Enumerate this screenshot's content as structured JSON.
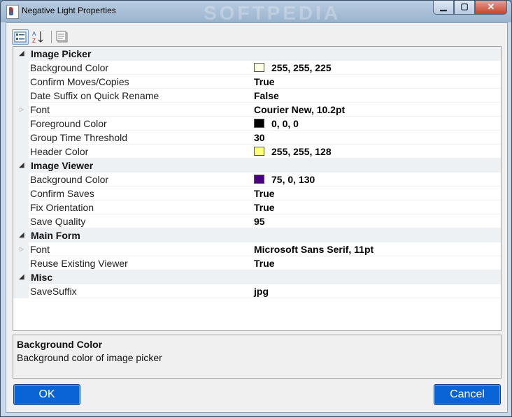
{
  "window": {
    "title": "Negative Light Properties",
    "watermark": "SOFTPEDIA",
    "minimize_glyph": "▁",
    "maximize_glyph": "▢",
    "close_glyph": "✕"
  },
  "toolbar": {
    "items": [
      "categorized-view",
      "alphabetical-view",
      "property-pages"
    ],
    "az_label": "A↓Z"
  },
  "grid": {
    "collapse_glyph": "◢",
    "expand_glyph": "▷",
    "categories": [
      {
        "name": "Image Picker",
        "properties": [
          {
            "name": "Background Color",
            "value": "255, 255, 225",
            "swatch": "#ffffe1"
          },
          {
            "name": "Confirm Moves/Copies",
            "value": "True"
          },
          {
            "name": "Date Suffix on Quick Rename",
            "value": "False"
          },
          {
            "name": "Font",
            "value": "Courier New, 10.2pt",
            "expandable": true
          },
          {
            "name": "Foreground Color",
            "value": "0, 0, 0",
            "swatch": "#000000"
          },
          {
            "name": "Group Time Threshold",
            "value": "30"
          },
          {
            "name": "Header Color",
            "value": "255, 255, 128",
            "swatch": "#ffff80"
          }
        ]
      },
      {
        "name": "Image Viewer",
        "properties": [
          {
            "name": "Background Color",
            "value": "75, 0, 130",
            "swatch": "#4b0082"
          },
          {
            "name": "Confirm Saves",
            "value": "True"
          },
          {
            "name": "Fix Orientation",
            "value": "True"
          },
          {
            "name": "Save Quality",
            "value": "95"
          }
        ]
      },
      {
        "name": "Main Form",
        "properties": [
          {
            "name": "Font",
            "value": "Microsoft Sans Serif, 11pt",
            "expandable": true
          },
          {
            "name": "Reuse Existing Viewer",
            "value": "True"
          }
        ]
      },
      {
        "name": "Misc",
        "properties": [
          {
            "name": "SaveSuffix",
            "value": "jpg"
          }
        ]
      }
    ]
  },
  "description": {
    "title": "Background Color",
    "text": "Background color of image picker"
  },
  "buttons": {
    "ok_label": "OK",
    "cancel_label": "Cancel"
  },
  "colors": {
    "accent_button": "#0a64d6",
    "category_bg": "#eef1f4"
  }
}
